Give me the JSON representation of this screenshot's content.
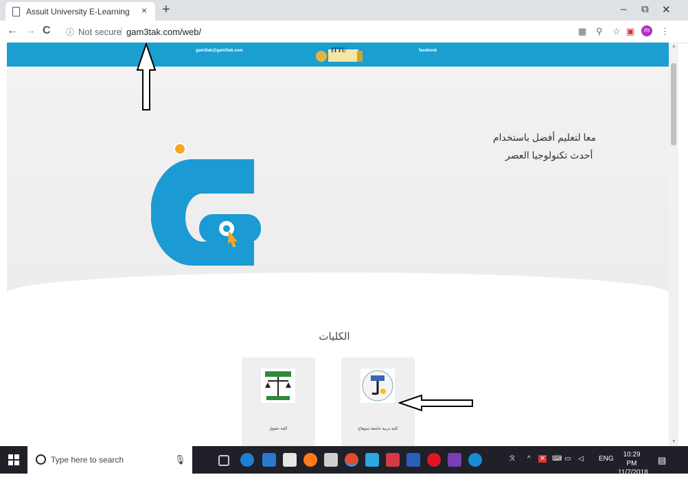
{
  "browser": {
    "tab_title": "Assuit University E-Learning",
    "tab_close": "×",
    "new_tab": "+",
    "minimize": "–",
    "restore": "⧉",
    "close": "✕",
    "back": "←",
    "forward": "→",
    "reload": "C",
    "info_icon": "ⓘ",
    "not_secure": "Not secure",
    "separator": "|",
    "url": "gam3tak.com/web/",
    "avatar_letter": "m"
  },
  "site": {
    "email": "gam3tak@gam3tak.com",
    "facebook": "facebook",
    "logo_text": "ITTU",
    "hero_line1": "معا لتعليم أفضل باستخدام",
    "hero_line2": "أحدث تكنولوجيا العصر",
    "colleges_title": "الكليات",
    "colleges": [
      {
        "name": "كلية حقوق"
      },
      {
        "name": "كلية تربية جامعة سوهاج"
      }
    ],
    "brand_color": "#1a9fd0"
  },
  "taskbar": {
    "search_placeholder": "Type here to search",
    "tray_lang": "ENG",
    "time": "10:29 PM",
    "date": "11/7/2018"
  }
}
